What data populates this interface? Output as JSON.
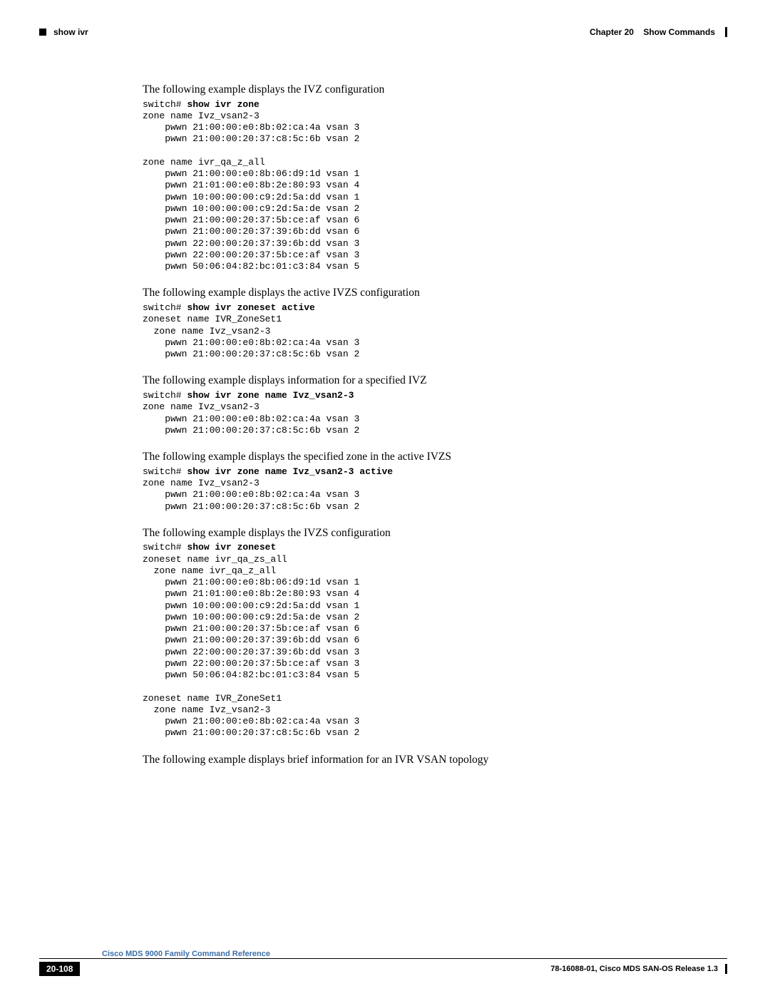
{
  "header": {
    "chapter": "Chapter 20",
    "title": "Show Commands",
    "command": "show ivr"
  },
  "sections": [
    {
      "para": "The following example displays the IVZ configuration",
      "prompt": "switch# ",
      "cmd": "show ivr zone",
      "out": "zone name Ivz_vsan2-3\n    pwwn 21:00:00:e0:8b:02:ca:4a vsan 3\n    pwwn 21:00:00:20:37:c8:5c:6b vsan 2\n\nzone name ivr_qa_z_all\n    pwwn 21:00:00:e0:8b:06:d9:1d vsan 1\n    pwwn 21:01:00:e0:8b:2e:80:93 vsan 4\n    pwwn 10:00:00:00:c9:2d:5a:dd vsan 1\n    pwwn 10:00:00:00:c9:2d:5a:de vsan 2\n    pwwn 21:00:00:20:37:5b:ce:af vsan 6\n    pwwn 21:00:00:20:37:39:6b:dd vsan 6\n    pwwn 22:00:00:20:37:39:6b:dd vsan 3\n    pwwn 22:00:00:20:37:5b:ce:af vsan 3\n    pwwn 50:06:04:82:bc:01:c3:84 vsan 5"
    },
    {
      "para": "The following example displays the active IVZS configuration",
      "prompt": "switch# ",
      "cmd": "show ivr zoneset active",
      "out": "zoneset name IVR_ZoneSet1\n  zone name Ivz_vsan2-3\n    pwwn 21:00:00:e0:8b:02:ca:4a vsan 3\n    pwwn 21:00:00:20:37:c8:5c:6b vsan 2"
    },
    {
      "para": "The following example displays information for a specified IVZ",
      "prompt": "switch# ",
      "cmd": "show ivr zone name Ivz_vsan2-3",
      "out": "zone name Ivz_vsan2-3\n    pwwn 21:00:00:e0:8b:02:ca:4a vsan 3\n    pwwn 21:00:00:20:37:c8:5c:6b vsan 2"
    },
    {
      "para": "The following example displays the specified zone in the active IVZS",
      "prompt": "switch# ",
      "cmd": "show ivr zone name Ivz_vsan2-3 active",
      "out": "zone name Ivz_vsan2-3\n    pwwn 21:00:00:e0:8b:02:ca:4a vsan 3\n    pwwn 21:00:00:20:37:c8:5c:6b vsan 2"
    },
    {
      "para": "The following example displays the IVZS configuration",
      "prompt": "switch# ",
      "cmd": "show ivr zoneset",
      "out": "zoneset name ivr_qa_zs_all\n  zone name ivr_qa_z_all\n    pwwn 21:00:00:e0:8b:06:d9:1d vsan 1\n    pwwn 21:01:00:e0:8b:2e:80:93 vsan 4\n    pwwn 10:00:00:00:c9:2d:5a:dd vsan 1\n    pwwn 10:00:00:00:c9:2d:5a:de vsan 2\n    pwwn 21:00:00:20:37:5b:ce:af vsan 6\n    pwwn 21:00:00:20:37:39:6b:dd vsan 6\n    pwwn 22:00:00:20:37:39:6b:dd vsan 3\n    pwwn 22:00:00:20:37:5b:ce:af vsan 3\n    pwwn 50:06:04:82:bc:01:c3:84 vsan 5\n\nzoneset name IVR_ZoneSet1\n  zone name Ivz_vsan2-3\n    pwwn 21:00:00:e0:8b:02:ca:4a vsan 3\n    pwwn 21:00:00:20:37:c8:5c:6b vsan 2"
    }
  ],
  "lastPara": "The following example displays brief information for an IVR VSAN topology",
  "footer": {
    "bookTitle": "Cisco MDS 9000 Family Command Reference",
    "page": "20-108",
    "pubInfo": "78-16088-01, Cisco MDS SAN-OS Release 1.3"
  }
}
